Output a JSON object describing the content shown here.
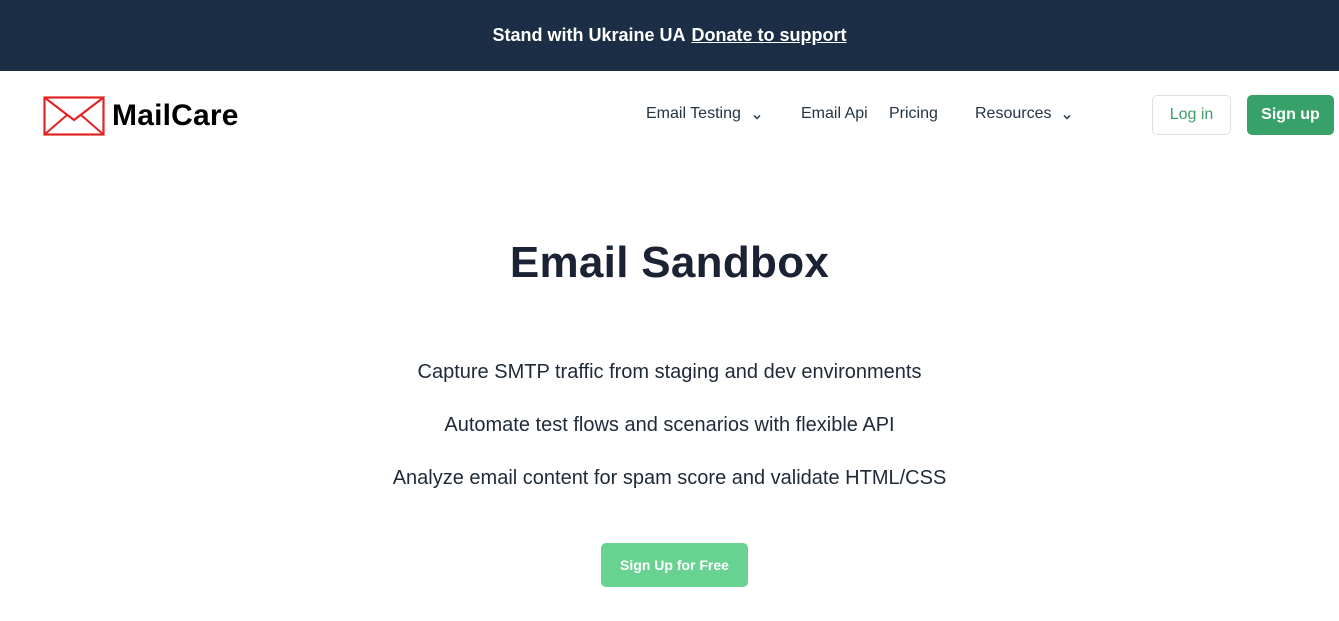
{
  "banner": {
    "text": "Stand with Ukraine UA",
    "link_label": "Donate to support"
  },
  "header": {
    "brand": "MailCare",
    "brand_icon": "envelope-icon",
    "nav": {
      "email_testing": "Email Testing",
      "email_api": "Email Api",
      "pricing": "Pricing",
      "resources": "Resources"
    },
    "login_label": "Log in",
    "signup_label": "Sign up"
  },
  "hero": {
    "title": "Email Sandbox",
    "features": [
      "Capture SMTP traffic from staging and dev environments",
      "Automate test flows and scenarios with flexible API",
      "Analyze email content for spam score and validate HTML/CSS"
    ],
    "cta_label": "Sign Up for Free"
  },
  "colors": {
    "banner_bg": "#1b2e45",
    "accent_green": "#38a169",
    "cta_green": "#68d391",
    "logo_red": "#e02424"
  }
}
